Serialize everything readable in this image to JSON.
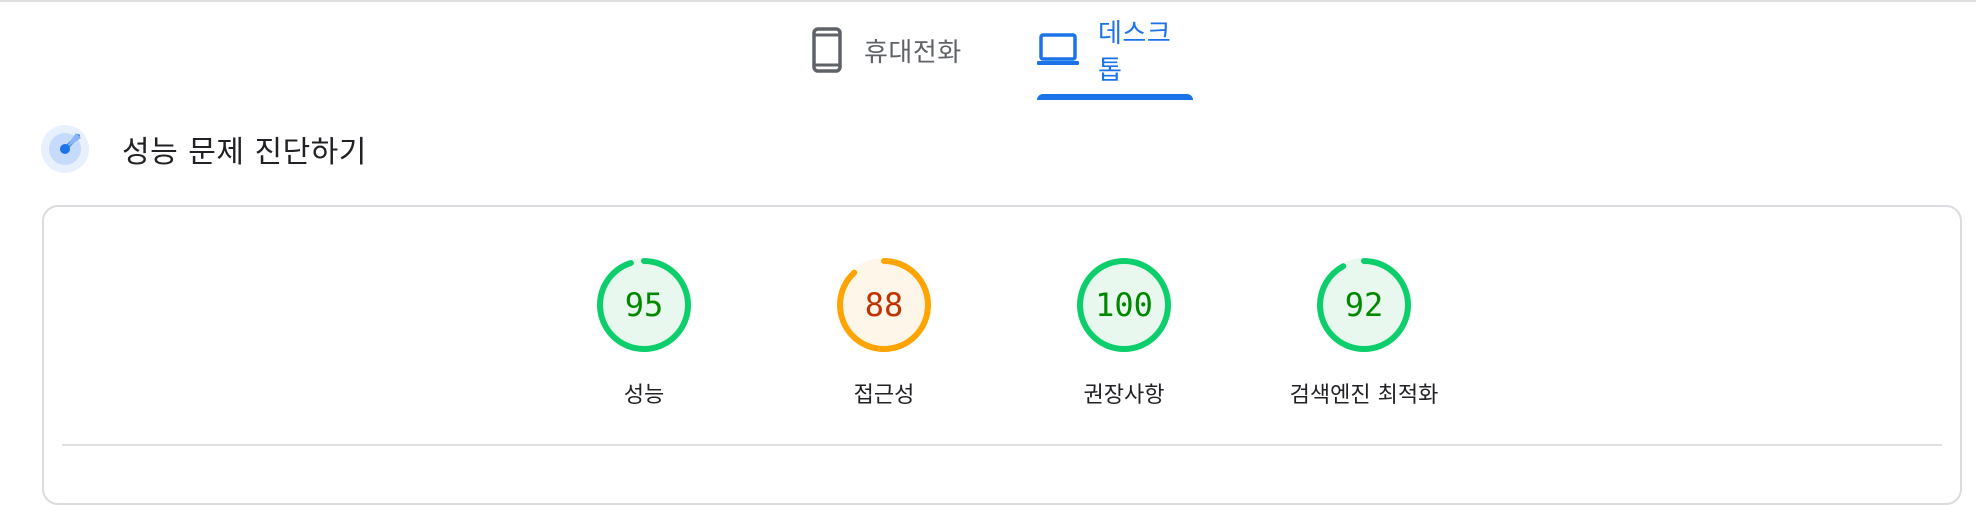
{
  "tabs": [
    {
      "label": "휴대전화",
      "icon": "smartphone-icon",
      "selected": false
    },
    {
      "label": "데스크톱",
      "icon": "laptop-icon",
      "selected": true
    }
  ],
  "section": {
    "title": "성능 문제 진단하기",
    "icon": "diagnose-icon"
  },
  "colors": {
    "accent": "#1a73e8",
    "pass": "#0cce6b",
    "pass_text": "#008800",
    "pass_fill": "#e9f8ef",
    "average": "#ffa400",
    "average_text": "#c33300",
    "average_fill": "#fff6ea"
  },
  "gauges": [
    {
      "score": "95",
      "label": "성능",
      "status": "pass"
    },
    {
      "score": "88",
      "label": "접근성",
      "status": "average"
    },
    {
      "score": "100",
      "label": "권장사항",
      "status": "pass"
    },
    {
      "score": "92",
      "label": "검색엔진 최적화",
      "status": "pass"
    }
  ]
}
